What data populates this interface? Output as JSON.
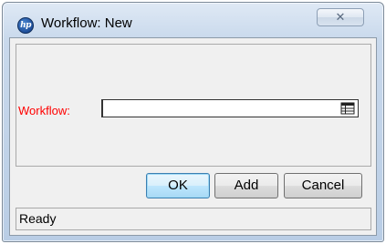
{
  "window": {
    "title": "Workflow: New",
    "app_icon_text": "hp",
    "close_label": "✕"
  },
  "form": {
    "workflow_label": "Workflow:",
    "workflow_value": "",
    "lookup_icon": "list-lookup-icon"
  },
  "buttons": {
    "ok": "OK",
    "add": "Add",
    "cancel": "Cancel"
  },
  "status": {
    "text": "Ready"
  },
  "colors": {
    "required_label": "#ff0000",
    "default_button_border": "#3c7fb1"
  }
}
